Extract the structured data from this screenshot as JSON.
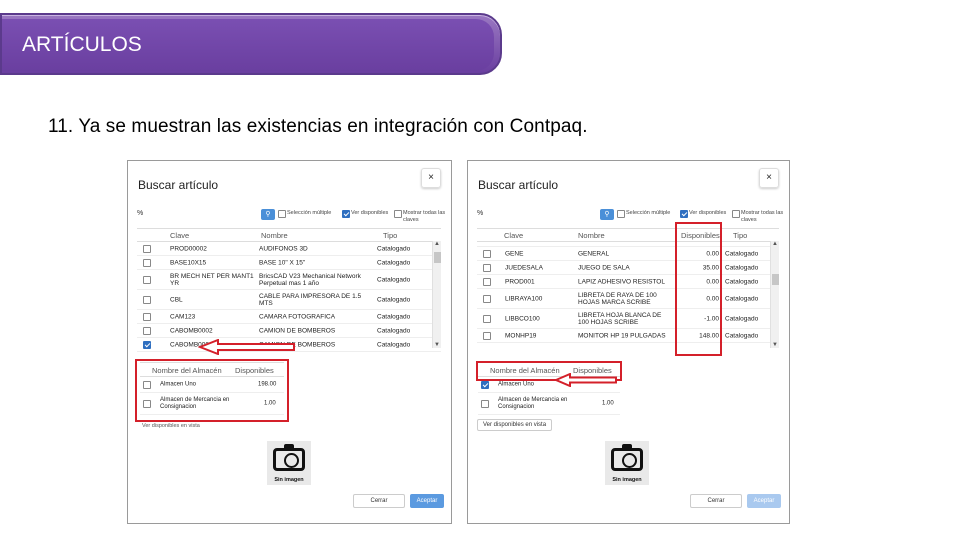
{
  "slide": {
    "title": "ARTÍCULOS",
    "step": "11. Ya se muestran las existencias en integración con Contpaq.",
    "accent": "#6a3fa0",
    "highlight": "#d4202a"
  },
  "left": {
    "dialog_title": "Buscar artículo",
    "close": "×",
    "search_prefix": "%",
    "opt_multiple": "Selección múltiple",
    "opt_available": "Ver disponibles",
    "opt_all_keys_1": "Mostrar todas las",
    "opt_all_keys_2": "claves",
    "col_clave": "Clave",
    "col_nombre": "Nombre",
    "col_tipo": "Tipo",
    "rows": [
      {
        "clave": "PROD00002",
        "nombre": "AUDIFONOS 3D",
        "tipo": "Catalogado"
      },
      {
        "clave": "BASE10X15",
        "nombre": "BASE 10\" X 15\"",
        "tipo": "Catalogado"
      },
      {
        "clave": "BR MECH NET PER MANT1 YR",
        "nombre": "BricsCAD V23 Mechanical Network Perpetual mas 1 año",
        "tipo": "Catalogado"
      },
      {
        "clave": "CBL",
        "nombre": "CABLE PARA IMPRESORA DE 1.5 MTS",
        "tipo": "Catalogado"
      },
      {
        "clave": "CAM123",
        "nombre": "CAMARA FOTOGRAFICA",
        "tipo": "Catalogado"
      },
      {
        "clave": "CABOMB0002",
        "nombre": "CAMION DE BOMBEROS",
        "tipo": "Catalogado"
      },
      {
        "clave": "CABOMB0001",
        "nombre": "CAMION DE BOMBEROS",
        "tipo": "Catalogado"
      }
    ],
    "wh_col_name": "Nombre del Almacén",
    "wh_col_avail": "Disponibles",
    "warehouses": [
      {
        "name": "Almacen Uno",
        "avail": "198.00"
      },
      {
        "name": "Almacen de Mercancia en Consignacion",
        "avail": "1.00"
      }
    ],
    "view_link": "Ver disponibles en vista",
    "no_image": "Sin imagen",
    "cancel": "Cerrar",
    "accept": "Aceptar"
  },
  "right": {
    "dialog_title": "Buscar artículo",
    "close": "×",
    "search_prefix": "%",
    "opt_multiple": "Selección múltiple",
    "opt_available": "Ver disponibles",
    "opt_all_keys_1": "Mostrar todas las",
    "opt_all_keys_2": "claves",
    "col_clave": "Clave",
    "col_nombre": "Nombre",
    "col_disp": "Disponibles",
    "col_tipo": "Tipo",
    "rows": [
      {
        "clave": "GENE",
        "nombre": "GENERAL",
        "disp": "0.00",
        "tipo": "Catalogado"
      },
      {
        "clave": "JUEDESALA",
        "nombre": "JUEGO DE SALA",
        "disp": "35.00",
        "tipo": "Catalogado"
      },
      {
        "clave": "PROD001",
        "nombre": "LAPIZ ADHESIVO RESISTOL",
        "disp": "0.00",
        "tipo": "Catalogado"
      },
      {
        "clave": "LIBRAYA100",
        "nombre": "LIBRETA DE RAYA DE 100 HOJAS MARCA SCRIBE",
        "disp": "0.00",
        "tipo": "Catalogado"
      },
      {
        "clave": "LIBBCO100",
        "nombre": "LIBRETA HOJA BLANCA DE 100 HOJAS SCRIBE",
        "disp": "-1.00",
        "tipo": "Catalogado"
      },
      {
        "clave": "MONHP19",
        "nombre": "MONITOR HP 19 PULGADAS",
        "disp": "148.00",
        "tipo": "Catalogado"
      }
    ],
    "wh_col_name": "Nombre del Almacén",
    "wh_col_avail": "Disponibles",
    "warehouses": [
      {
        "name": "Almacen Uno",
        "avail": ""
      },
      {
        "name": "Almacen de Mercancia en Consignacion",
        "avail": "1.00"
      }
    ],
    "view_button": "Ver disponibles en vista",
    "no_image": "Sin imagen",
    "cancel": "Cerrar",
    "accept": "Aceptar"
  }
}
